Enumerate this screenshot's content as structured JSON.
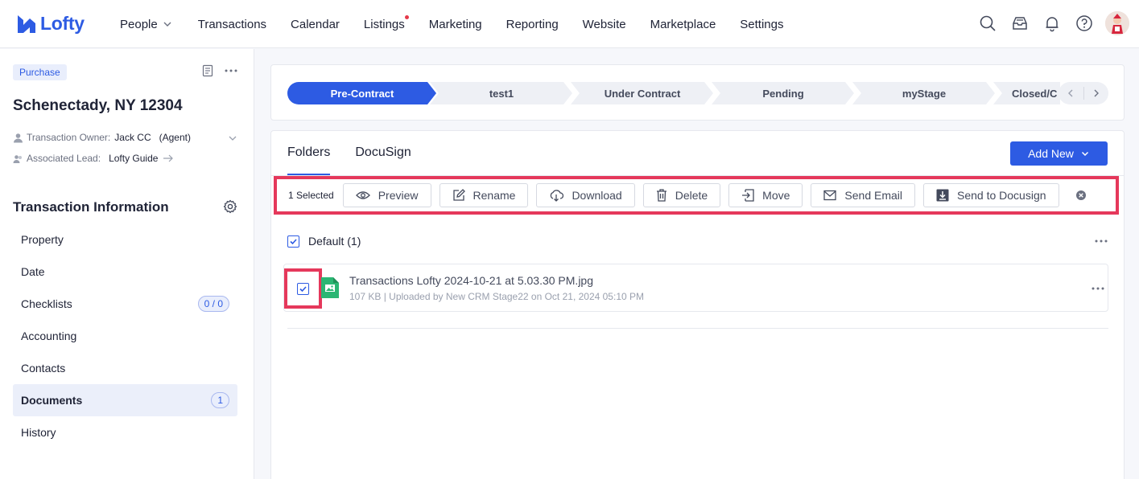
{
  "brand": {
    "name": "Lofty",
    "color": "#2d5be3"
  },
  "nav": {
    "items": [
      {
        "label": "People",
        "has_chevron": true
      },
      {
        "label": "Transactions"
      },
      {
        "label": "Calendar"
      },
      {
        "label": "Listings",
        "has_dot": true
      },
      {
        "label": "Marketing"
      },
      {
        "label": "Reporting"
      },
      {
        "label": "Website"
      },
      {
        "label": "Marketplace"
      },
      {
        "label": "Settings"
      }
    ],
    "icons": [
      "search-icon",
      "inbox-icon",
      "bell-icon",
      "help-icon"
    ]
  },
  "sidebar": {
    "type_badge": "Purchase",
    "address": "Schenectady, NY 12304",
    "owner_label": "Transaction Owner:",
    "owner_name": "Jack CC",
    "owner_role": "(Agent)",
    "lead_label": "Associated Lead:",
    "lead_name": "Lofty Guide",
    "section_title": "Transaction Information",
    "items": [
      {
        "label": "Property"
      },
      {
        "label": "Date"
      },
      {
        "label": "Checklists",
        "count": "0 / 0"
      },
      {
        "label": "Accounting"
      },
      {
        "label": "Contacts"
      },
      {
        "label": "Documents",
        "count": "1",
        "active": true
      },
      {
        "label": "History"
      }
    ]
  },
  "stages": [
    {
      "label": "Pre-Contract",
      "active": true
    },
    {
      "label": "test1"
    },
    {
      "label": "Under Contract"
    },
    {
      "label": "Pending"
    },
    {
      "label": "myStage"
    },
    {
      "label": "Closed/C"
    }
  ],
  "documents": {
    "tabs": [
      {
        "label": "Folders",
        "active": true
      },
      {
        "label": "DocuSign"
      }
    ],
    "add_new_label": "Add New",
    "selected_text": "1 Selected",
    "actions": [
      {
        "label": "Preview",
        "icon": "eye-icon"
      },
      {
        "label": "Rename",
        "icon": "edit-icon"
      },
      {
        "label": "Download",
        "icon": "cloud-download-icon"
      },
      {
        "label": "Delete",
        "icon": "trash-icon"
      },
      {
        "label": "Move",
        "icon": "move-icon"
      },
      {
        "label": "Send Email",
        "icon": "mail-icon"
      },
      {
        "label": "Send to Docusign",
        "icon": "docusign-icon"
      }
    ],
    "folder": {
      "label": "Default (1)",
      "checked": true
    },
    "file": {
      "name": "Transactions Lofty 2024-10-21 at 5.03.30 PM.jpg",
      "meta": "107 KB | Uploaded by New CRM Stage22 on Oct 21, 2024 05:10 PM",
      "checked": true
    }
  },
  "colors": {
    "accent": "#2d5be3",
    "highlight_border": "#e5385b",
    "file_icon": "#2bb673"
  }
}
